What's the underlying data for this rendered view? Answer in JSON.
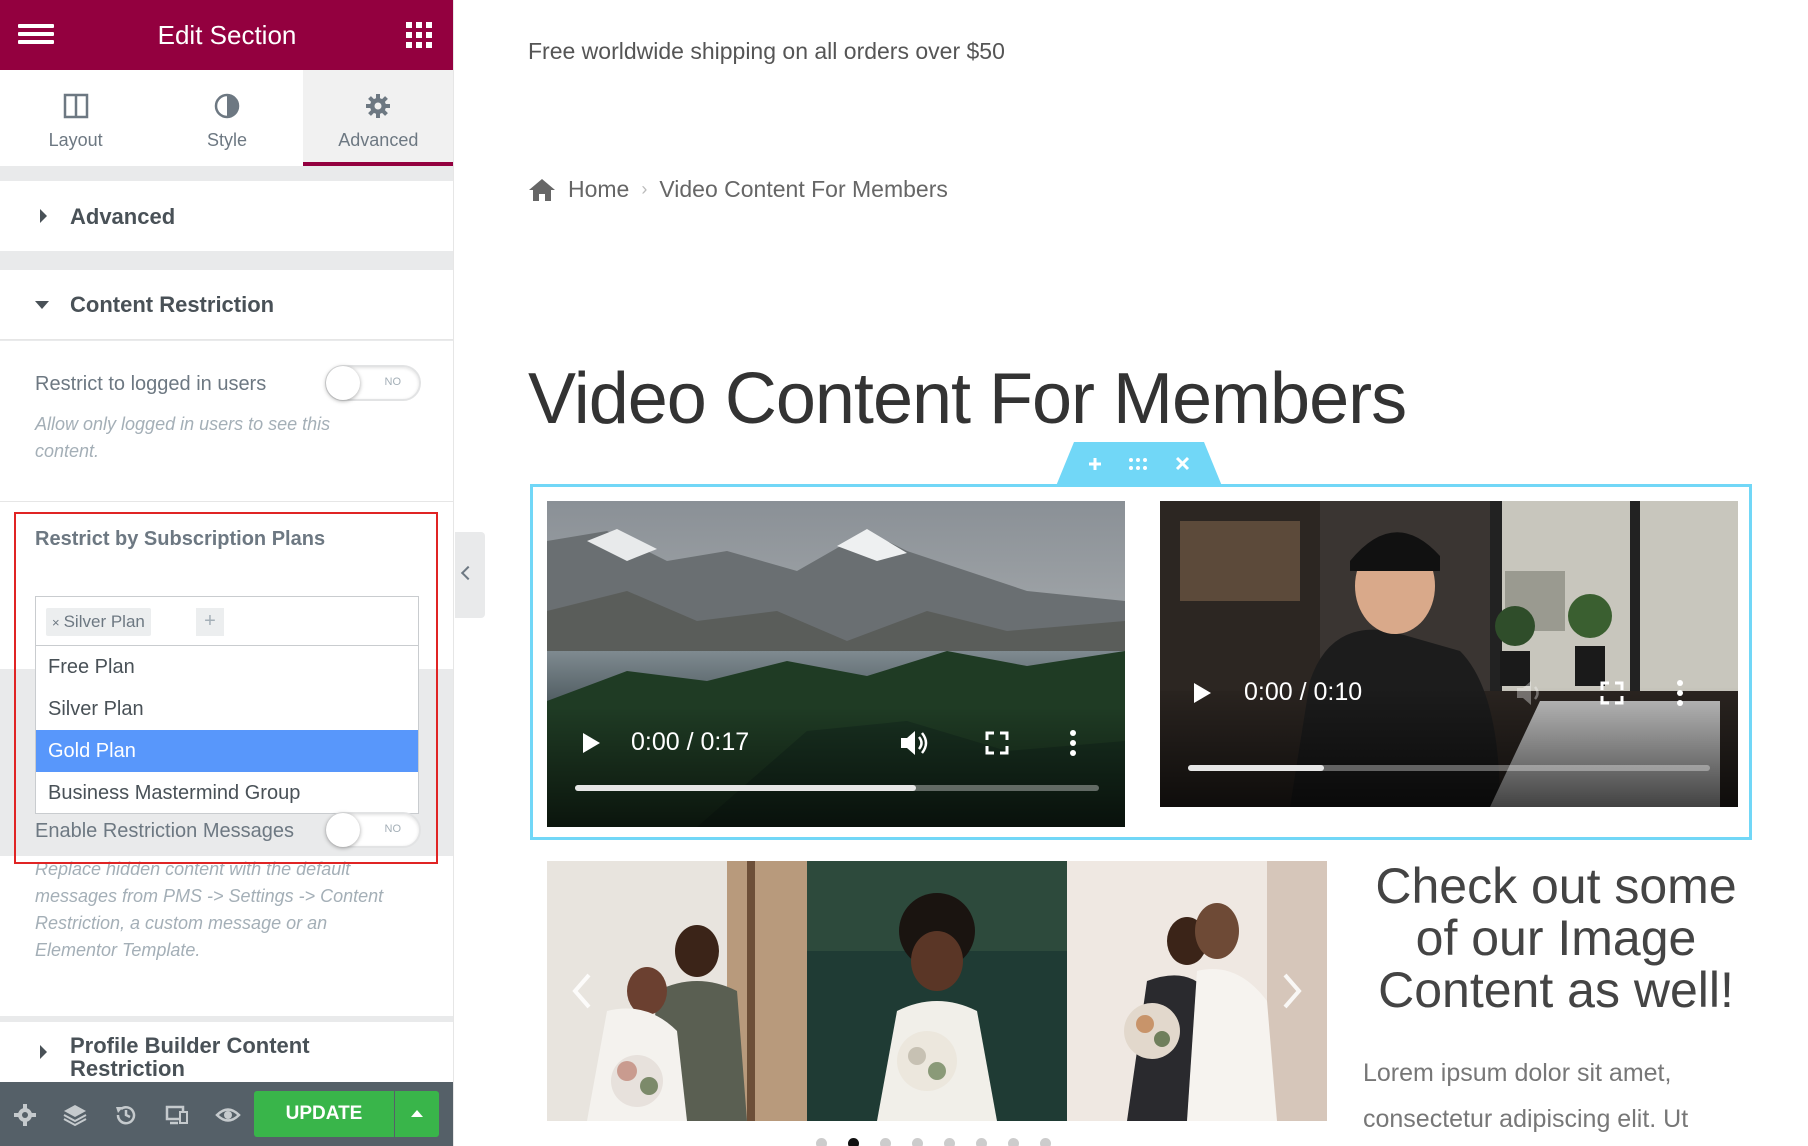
{
  "panel": {
    "header_title": "Edit Section",
    "tabs": [
      {
        "label": "Layout",
        "icon": "columns-icon"
      },
      {
        "label": "Style",
        "icon": "half-circle-icon"
      },
      {
        "label": "Advanced",
        "icon": "gear-icon"
      }
    ],
    "active_tab": "Advanced",
    "sections": {
      "advanced_label": "Advanced",
      "content_restriction_label": "Content Restriction",
      "profile_builder_line1": "Profile Builder Content",
      "profile_builder_line2": "Restriction"
    },
    "restrict_logged": {
      "label": "Restrict to logged in users",
      "switch_text": "NO",
      "desc_line1": "Allow only logged in users to see this",
      "desc_line2": "content."
    },
    "subscription": {
      "label": "Restrict by Subscription Plans",
      "selected_chip": "Silver Plan",
      "chip_remove": "×",
      "chip_add": "+",
      "options": [
        "Free Plan",
        "Silver Plan",
        "Gold Plan",
        "Business Mastermind Group"
      ],
      "highlighted": "Gold Plan"
    },
    "restriction_messages": {
      "label": "Enable Restriction Messages",
      "switch_text": "NO",
      "desc_line1": "Replace hidden content with the default",
      "desc_line2": "messages from PMS -> Settings -> Content",
      "desc_line3": "Restriction, a custom message or an",
      "desc_line4": "Elementor Template."
    },
    "update_label": "UPDATE",
    "colors": {
      "brand": "#93003f",
      "update": "#39b54a",
      "highlight": "#5897fb",
      "selection": "#71d7f7"
    }
  },
  "preview": {
    "shipping": "Free worldwide shipping on all orders over $50",
    "breadcrumb": {
      "home": "Home",
      "current": "Video Content For Members"
    },
    "title": "Video Content For Members",
    "videos": [
      {
        "time": "0:00 / 0:17",
        "progress": 0.65
      },
      {
        "time": "0:00 / 0:10",
        "progress": 0.26
      }
    ],
    "side_heading_lines": [
      "Check out some",
      "of our Image",
      "Content as well!"
    ],
    "side_para_lines": [
      "Lorem ipsum dolor sit amet,",
      "consectetur adipiscing elit. Ut"
    ],
    "carousel": {
      "dot_count": 8,
      "active_dot": 1
    }
  }
}
